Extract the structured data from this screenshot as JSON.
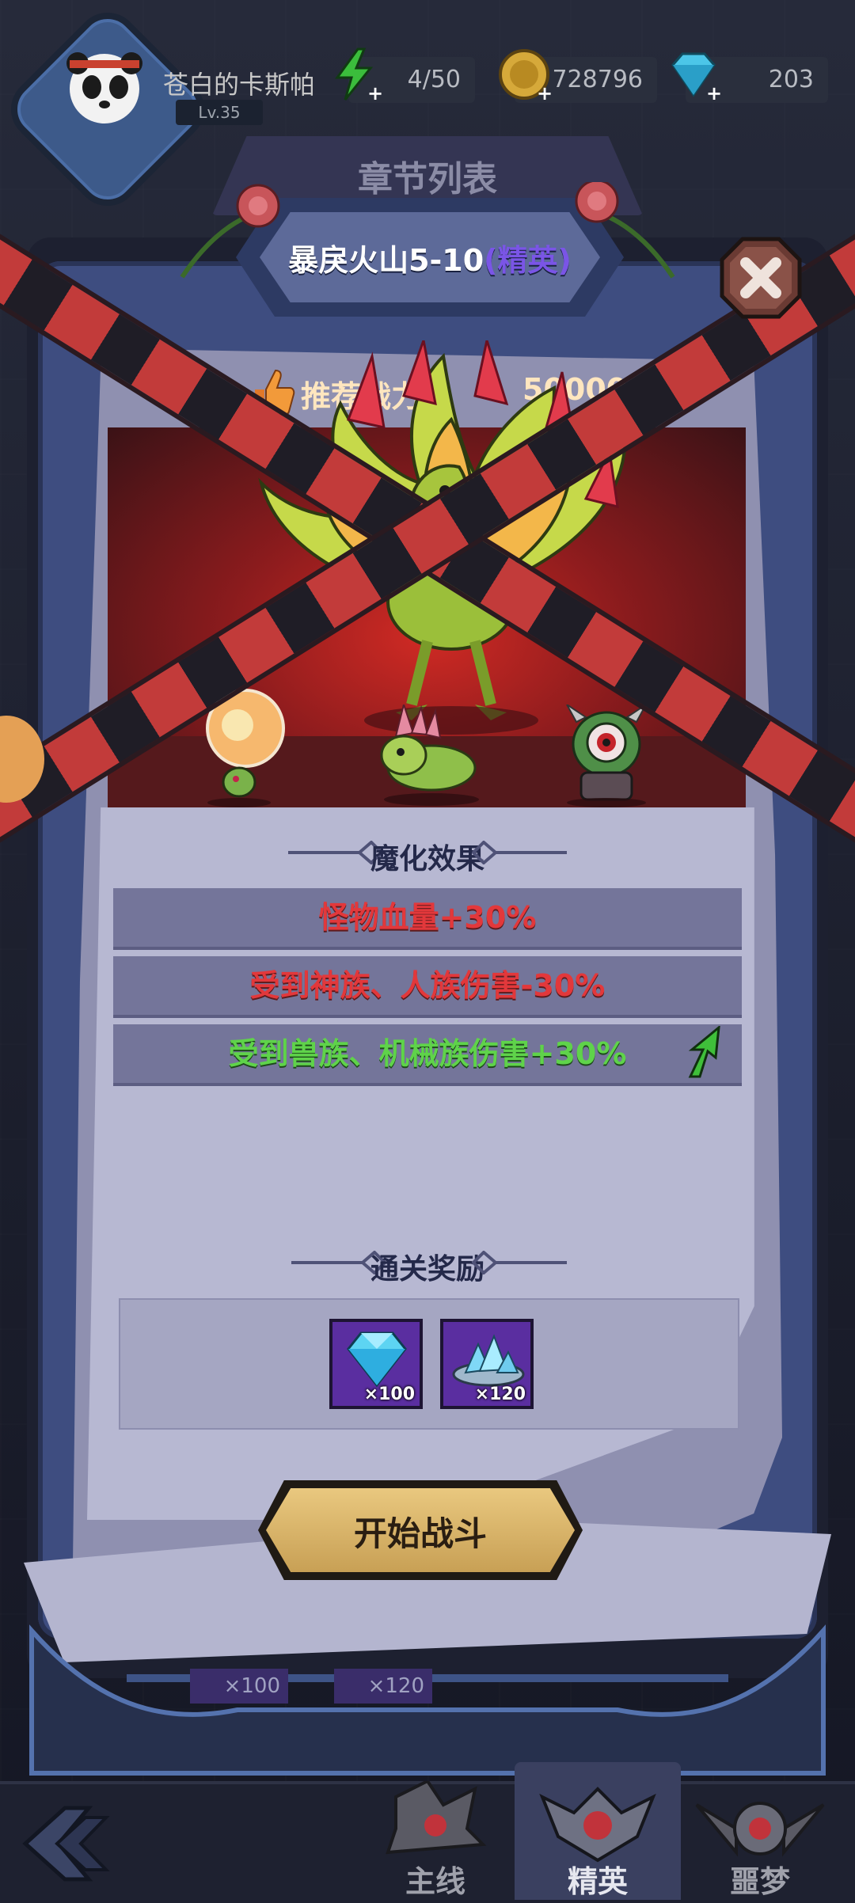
{
  "player": {
    "name": "苍白的卡斯帕",
    "level": "Lv.35"
  },
  "resources": {
    "energy": "4/50",
    "gold": "728796",
    "gems": "203"
  },
  "chapter_list_label": "章节列表",
  "stage": {
    "title": "暴戾火山5-10",
    "tag": "(精英)"
  },
  "recommend": {
    "label": "推荐战力",
    "value": "500000"
  },
  "effects": {
    "header": "魔化效果",
    "rows": [
      {
        "text": "怪物血量+30%",
        "color": "red"
      },
      {
        "text": "受到神族、人族伤害-30%",
        "color": "red"
      },
      {
        "text": "受到兽族、机械族伤害+30%",
        "color": "green"
      }
    ]
  },
  "rewards": {
    "header": "通关奖励",
    "items": [
      {
        "icon": "diamond-icon",
        "count": "×100"
      },
      {
        "icon": "crystal-pile-icon",
        "count": "×120"
      }
    ]
  },
  "start_button": "开始战斗",
  "background_items": [
    "×100",
    "×120"
  ],
  "nav": {
    "tabs": [
      {
        "label": "主线",
        "active": false
      },
      {
        "label": "精英",
        "active": true
      },
      {
        "label": "噩梦",
        "active": false
      }
    ]
  },
  "colors": {
    "effect_red": "#e2383b",
    "effect_green": "#5fd34a",
    "elite_tag": "#7a55e6",
    "button_gold": "#d9b46a"
  }
}
